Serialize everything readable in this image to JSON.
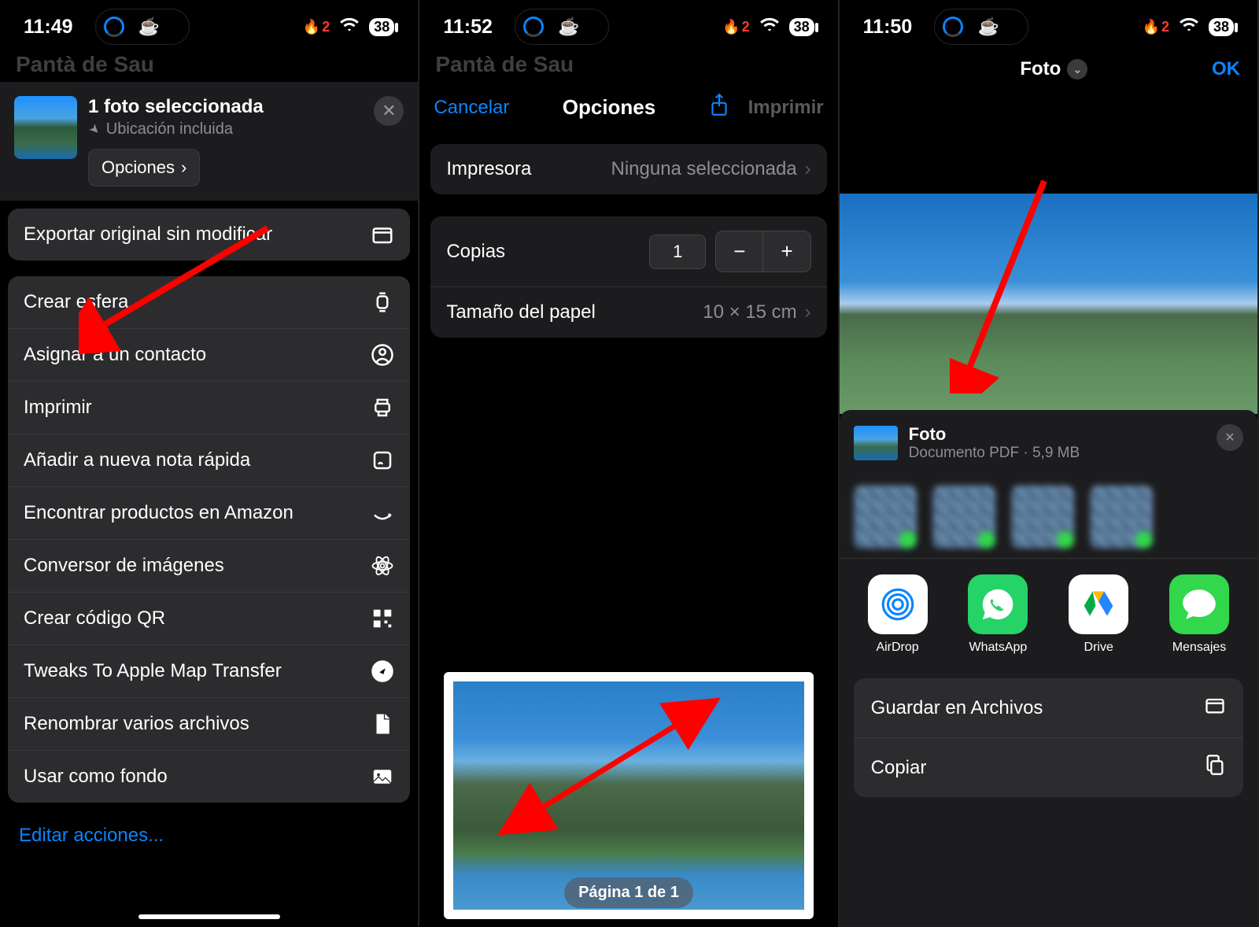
{
  "status": {
    "time1": "11:49",
    "time2": "11:52",
    "time3": "11:50",
    "flame_count": "2",
    "battery": "38"
  },
  "dim_title": "Pantà de Sau",
  "screen1": {
    "selected": "1 foto seleccionada",
    "location": "Ubicación incluida",
    "options_btn": "Opciones",
    "export": "Exportar original sin modificar",
    "rows": [
      {
        "label": "Crear esfera",
        "icon": "watch"
      },
      {
        "label": "Asignar a un contacto",
        "icon": "contact"
      },
      {
        "label": "Imprimir",
        "icon": "printer"
      },
      {
        "label": "Añadir a nueva nota rápida",
        "icon": "note"
      },
      {
        "label": "Encontrar productos en Amazon",
        "icon": "amazon"
      },
      {
        "label": "Conversor de imágenes",
        "icon": "atom"
      },
      {
        "label": "Crear código QR",
        "icon": "qr"
      },
      {
        "label": "Tweaks To Apple Map Transfer",
        "icon": "compass"
      },
      {
        "label": "Renombrar varios archivos",
        "icon": "doc"
      },
      {
        "label": "Usar como fondo",
        "icon": "image"
      }
    ],
    "edit": "Editar acciones..."
  },
  "screen2": {
    "cancel": "Cancelar",
    "title": "Opciones",
    "print": "Imprimir",
    "printer_label": "Impresora",
    "printer_value": "Ninguna seleccionada",
    "copies_label": "Copias",
    "copies_value": "1",
    "paper_label": "Tamaño del papel",
    "paper_value": "10 × 15 cm",
    "page_badge": "Página 1 de 1"
  },
  "screen3": {
    "title": "Foto",
    "ok": "OK",
    "doc_title": "Foto",
    "doc_sub": "Documento PDF · 5,9 MB",
    "apps": {
      "airdrop": "AirDrop",
      "whatsapp": "WhatsApp",
      "drive": "Drive",
      "messages": "Mensajes"
    },
    "actions": {
      "save_files": "Guardar en Archivos",
      "copy": "Copiar"
    }
  }
}
